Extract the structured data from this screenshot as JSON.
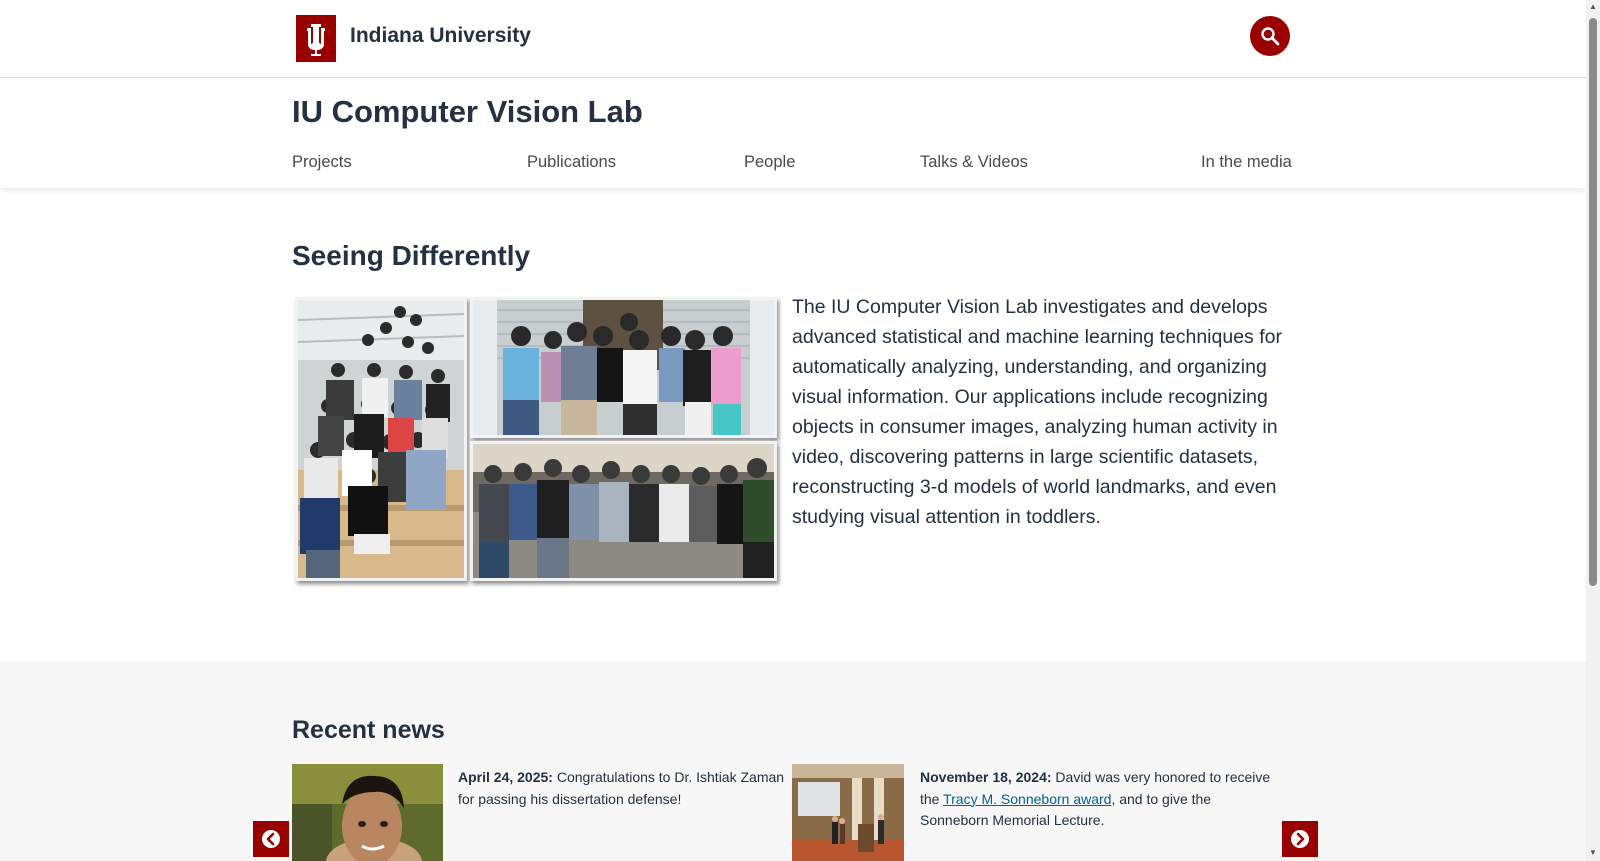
{
  "global_header": {
    "brand": "Indiana University",
    "logo_icon": "iu-trident-icon",
    "search_icon": "search-icon",
    "brand_color": "#990000"
  },
  "site": {
    "title": "IU Computer Vision Lab",
    "nav": [
      "Projects",
      "Publications",
      "People",
      "Talks & Videos",
      "In the media"
    ]
  },
  "hero": {
    "title": "Seeing Differently",
    "paragraph": "The IU Computer Vision Lab investigates and develops advanced statistical and machine learning techniques for automatically analyzing, understanding, and organizing visual information. Our applications include recognizing objects in consumer images, analyzing human activity in video, discovering patterns in large scientific datasets, reconstructing 3-d models of world landmarks, and even studying visual attention in toddlers."
  },
  "news": {
    "title": "Recent news",
    "items": [
      {
        "date": "April 24, 2025:",
        "text_before": " Congratulations to Dr. Ishtiak Zaman for passing his dissertation defense!",
        "link": "",
        "text_after": ""
      },
      {
        "date": "November 18, 2024:",
        "text_before": " David was very honored to receive the ",
        "link": "Tracy M. Sonneborn award",
        "text_after": ", and to give the Sonneborn Memorial Lecture."
      }
    ],
    "prev_icon": "chevron-left-circle-icon",
    "next_icon": "chevron-right-circle-icon"
  }
}
